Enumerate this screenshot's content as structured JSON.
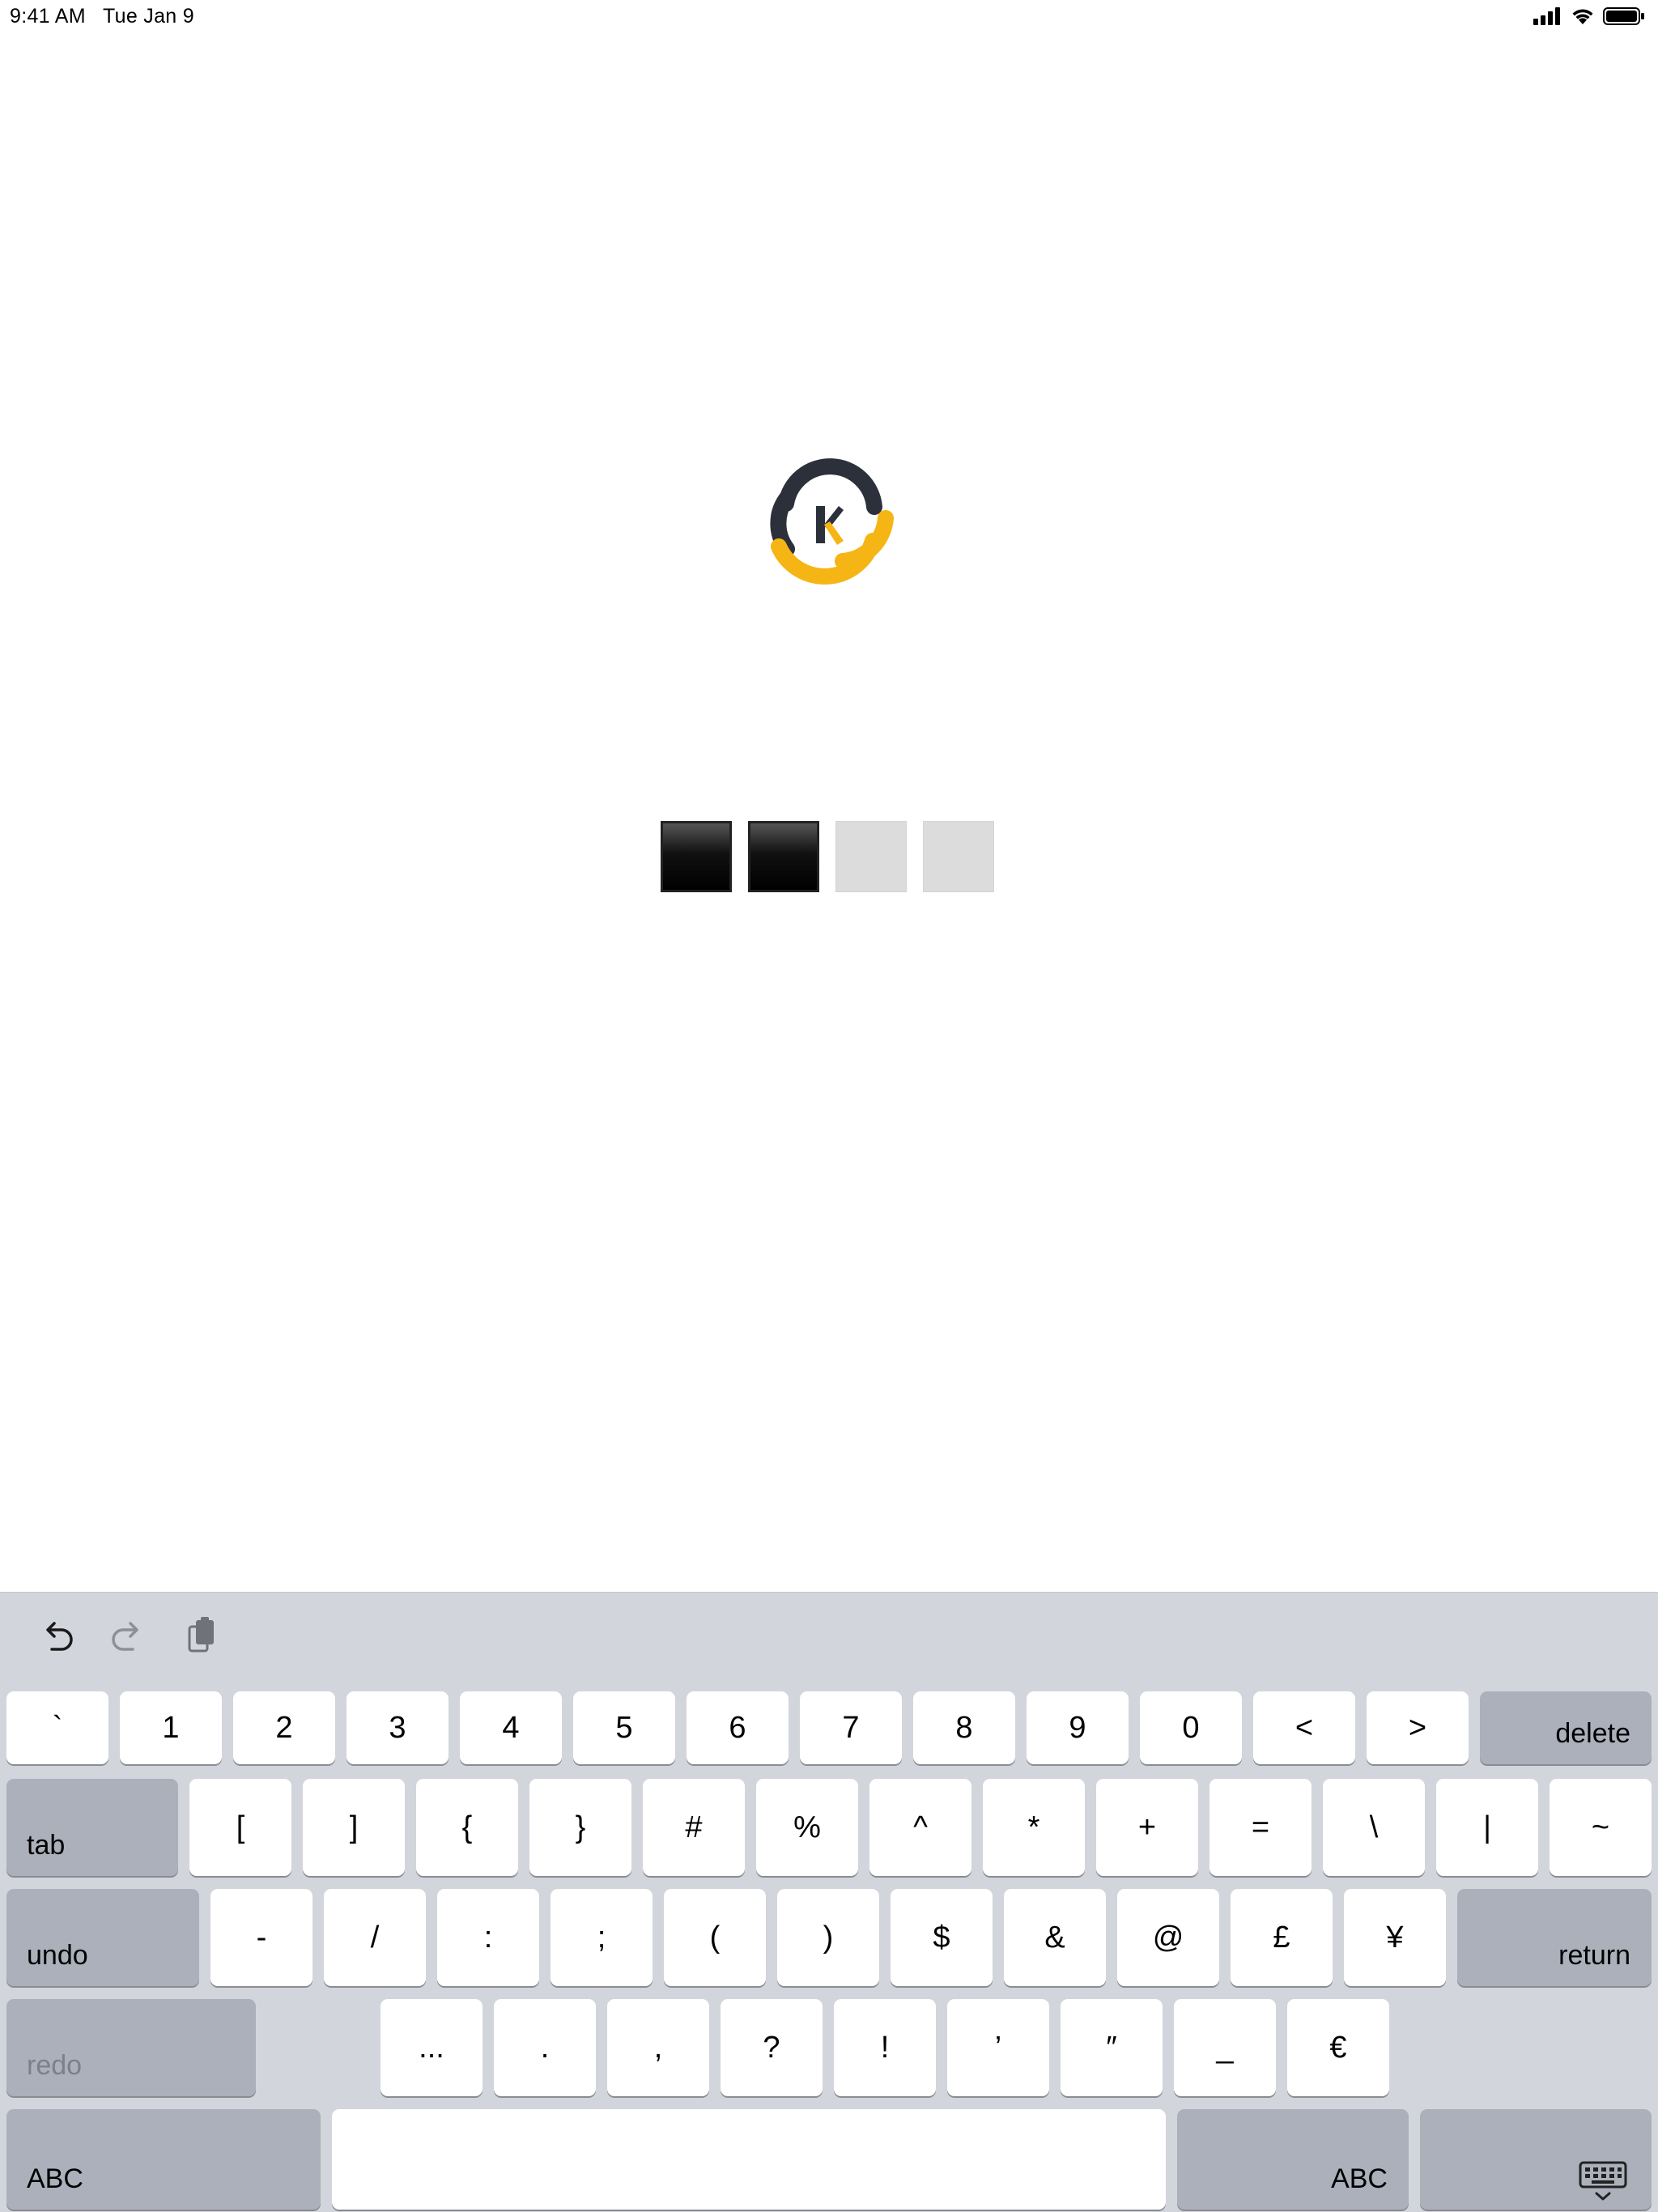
{
  "status_bar": {
    "time": "9:41 AM",
    "date": "Tue Jan 9",
    "icons": [
      "cellular-signal-icon",
      "wifi-icon",
      "battery-icon"
    ]
  },
  "logo": {
    "letter": "K",
    "colors": {
      "dark": "#2b303b",
      "accent": "#f5b514"
    }
  },
  "passcode": {
    "length": 4,
    "entered": 2,
    "colors": {
      "filled": "#000000",
      "empty": "#dcdcdc"
    }
  },
  "keyboard": {
    "toolbar": [
      "undo-icon",
      "redo-icon",
      "clipboard-icon"
    ],
    "row1": [
      "`",
      "1",
      "2",
      "3",
      "4",
      "5",
      "6",
      "7",
      "8",
      "9",
      "0",
      "<",
      ">"
    ],
    "delete_label": "delete",
    "tab_label": "tab",
    "row2": [
      "[",
      "]",
      "{",
      "}",
      "#",
      "%",
      "^",
      "*",
      "+",
      "=",
      "\\",
      "|",
      "~"
    ],
    "undo_label": "undo",
    "row3": [
      "-",
      "/",
      ":",
      ";",
      "(",
      ")",
      "$",
      "&",
      "@",
      "£",
      "¥"
    ],
    "return_label": "return",
    "redo_label": "redo",
    "row4": [
      "...",
      ".",
      ",",
      "?",
      "!",
      "’",
      "″",
      "_",
      "€"
    ],
    "abc_left_label": "ABC",
    "abc_right_label": "ABC",
    "dismiss_icon": "keyboard-dismiss-icon",
    "colors": {
      "background": "#d3d5dc",
      "key": "#ffffff",
      "function_key": "#abb0bb"
    }
  }
}
